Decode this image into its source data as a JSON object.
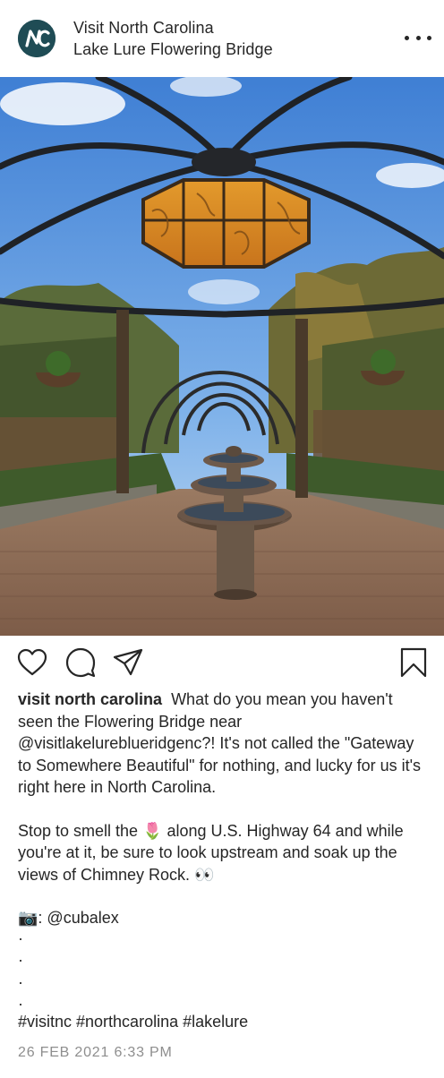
{
  "header": {
    "account_name": "Visit North Carolina",
    "location": "Lake Lure Flowering Bridge",
    "avatar_text": "NC",
    "avatar_color": "#1f4c55",
    "more_icon": "more-horizontal-icon"
  },
  "photo": {
    "alt": "Flowering Bridge with fountain and gazebo"
  },
  "actions": {
    "like_icon": "heart-icon",
    "comment_icon": "comment-icon",
    "share_icon": "send-icon",
    "save_icon": "bookmark-icon"
  },
  "caption": {
    "username": "visit north carolina",
    "para1": "What do you mean you haven't seen the Flowering Bridge near @visitlakelureblueridgenc?! It's not called the \"Gateway to Somewhere Beautiful\" for nothing, and lucky for us it's right here in North Carolina.",
    "para2_start": "Stop to smell the ",
    "para2_emoji": "🌷",
    "para2_rest": " along U.S. Highway 64 and while you're at it, be sure to look upstream and soak up the views of Chimney Rock. 👀",
    "credit_emoji": "📷",
    "credit_text": ": @cubalex",
    "dots": [
      "·",
      "·",
      "·",
      "·",
      "·"
    ],
    "hashtags": "#visitnc #northcarolina #lakelure"
  },
  "timestamp": "26 FEB 2021 6:33 PM",
  "colors": {
    "text": "#262626",
    "muted": "#8e8e8e"
  }
}
